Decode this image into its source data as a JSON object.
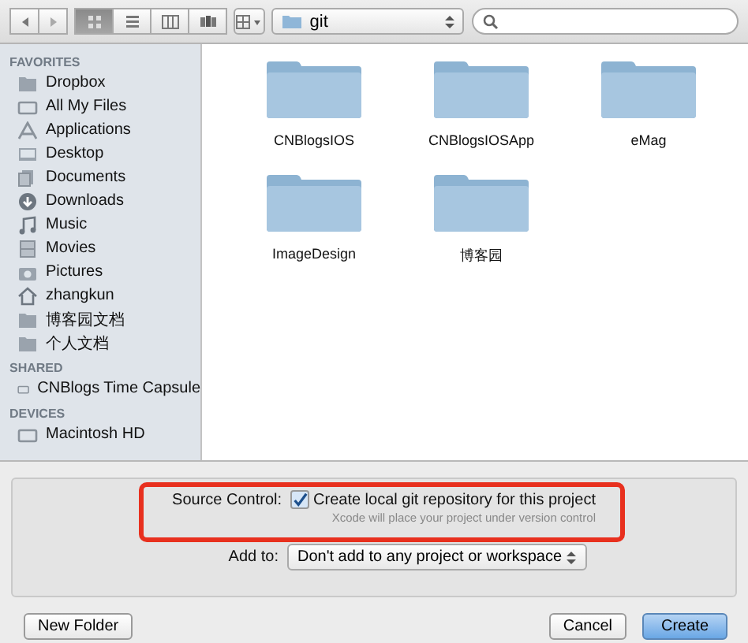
{
  "toolbar": {
    "view_modes": [
      {
        "selected": true
      },
      {
        "selected": false
      },
      {
        "selected": false
      },
      {
        "selected": false
      }
    ],
    "path": "git"
  },
  "sidebar": {
    "sections": [
      {
        "title": "FAVORITES",
        "items": [
          {
            "label": "Dropbox"
          },
          {
            "label": "All My Files"
          },
          {
            "label": "Applications"
          },
          {
            "label": "Desktop"
          },
          {
            "label": "Documents"
          },
          {
            "label": "Downloads"
          },
          {
            "label": "Music"
          },
          {
            "label": "Movies"
          },
          {
            "label": "Pictures"
          },
          {
            "label": "zhangkun"
          },
          {
            "label": "博客园文档"
          },
          {
            "label": "个人文档"
          }
        ]
      },
      {
        "title": "SHARED",
        "items": [
          {
            "label": "CNBlogs Time Capsule"
          }
        ]
      },
      {
        "title": "DEVICES",
        "items": [
          {
            "label": "Macintosh HD"
          }
        ]
      }
    ]
  },
  "folders": [
    {
      "name": "CNBlogsIOS"
    },
    {
      "name": "CNBlogsIOSApp"
    },
    {
      "name": "eMag"
    },
    {
      "name": "ImageDesign"
    },
    {
      "name": "博客园"
    }
  ],
  "options": {
    "source_control_label": "Source Control:",
    "git_checkbox": {
      "label": "Create local git repository for this project",
      "checked": true
    },
    "hint": "Xcode will place your project under version control",
    "add_to_label": "Add to:",
    "add_to_value": "Don't add to any project or workspace"
  },
  "buttons": {
    "new_folder": "New Folder",
    "cancel": "Cancel",
    "create": "Create"
  }
}
